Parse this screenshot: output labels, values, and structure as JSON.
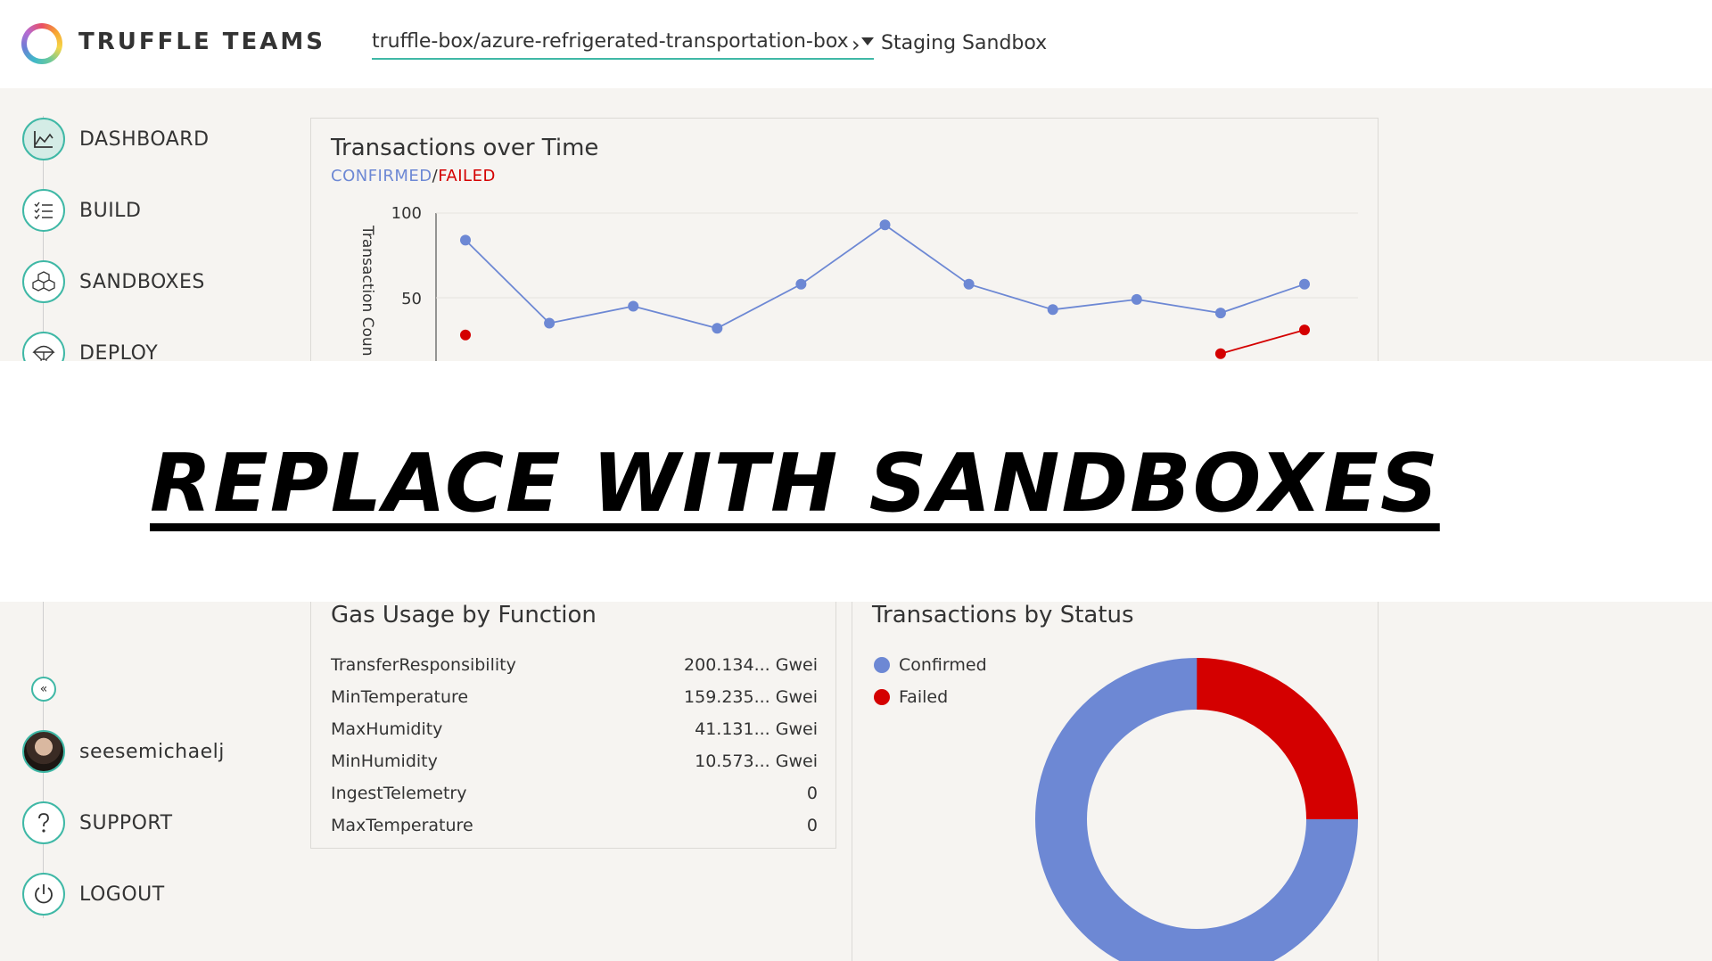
{
  "header": {
    "brand": "TRUFFLE TEAMS",
    "repo": "truffle-box/azure-refrigerated-transportation-box",
    "breadcrumb_sep": "›",
    "breadcrumb": "Staging Sandbox"
  },
  "sidebar": {
    "items": [
      {
        "label": "DASHBOARD",
        "icon": "chart-icon"
      },
      {
        "label": "BUILD",
        "icon": "checklist-icon"
      },
      {
        "label": "SANDBOXES",
        "icon": "cubes-icon"
      },
      {
        "label": "DEPLOY",
        "icon": "parachute-icon"
      }
    ],
    "collapse_icon": "«",
    "user": "seesemichaelj",
    "support": "SUPPORT",
    "logout": "LOGOUT"
  },
  "banner": {
    "text": "REPLACE WITH SANDBOXES"
  },
  "transactions_chart": {
    "title": "Transactions over Time",
    "legend_confirmed": "CONFIRMED",
    "legend_sep": "/",
    "legend_failed": "FAILED",
    "ylabel": "Transaction Coun",
    "ytick_100": "100",
    "ytick_50": "50"
  },
  "chart_data": {
    "type": "line",
    "title": "Transactions over Time",
    "ylabel": "Transaction Count",
    "ylim": [
      0,
      100
    ],
    "series": [
      {
        "name": "CONFIRMED",
        "color": "#6d88d4",
        "values": [
          84,
          35,
          45,
          32,
          58,
          93,
          58,
          43,
          49,
          41,
          58
        ]
      },
      {
        "name": "FAILED",
        "color": "#d40000",
        "values": [
          28,
          null,
          null,
          null,
          null,
          null,
          null,
          null,
          null,
          17,
          31
        ]
      }
    ]
  },
  "gas": {
    "title": "Gas Usage by Function",
    "rows": [
      {
        "name": "TransferResponsibility",
        "value": "200.134... Gwei"
      },
      {
        "name": "MinTemperature",
        "value": "159.235... Gwei"
      },
      {
        "name": "MaxHumidity",
        "value": "41.131... Gwei"
      },
      {
        "name": "MinHumidity",
        "value": "10.573... Gwei"
      },
      {
        "name": "IngestTelemetry",
        "value": "0"
      },
      {
        "name": "MaxTemperature",
        "value": "0"
      }
    ]
  },
  "status": {
    "title": "Transactions by Status",
    "confirmed_label": "Confirmed",
    "failed_label": "Failed",
    "confirmed_fraction": 0.75,
    "failed_fraction": 0.25,
    "confirmed_color": "#6d88d4",
    "failed_color": "#d40000"
  }
}
